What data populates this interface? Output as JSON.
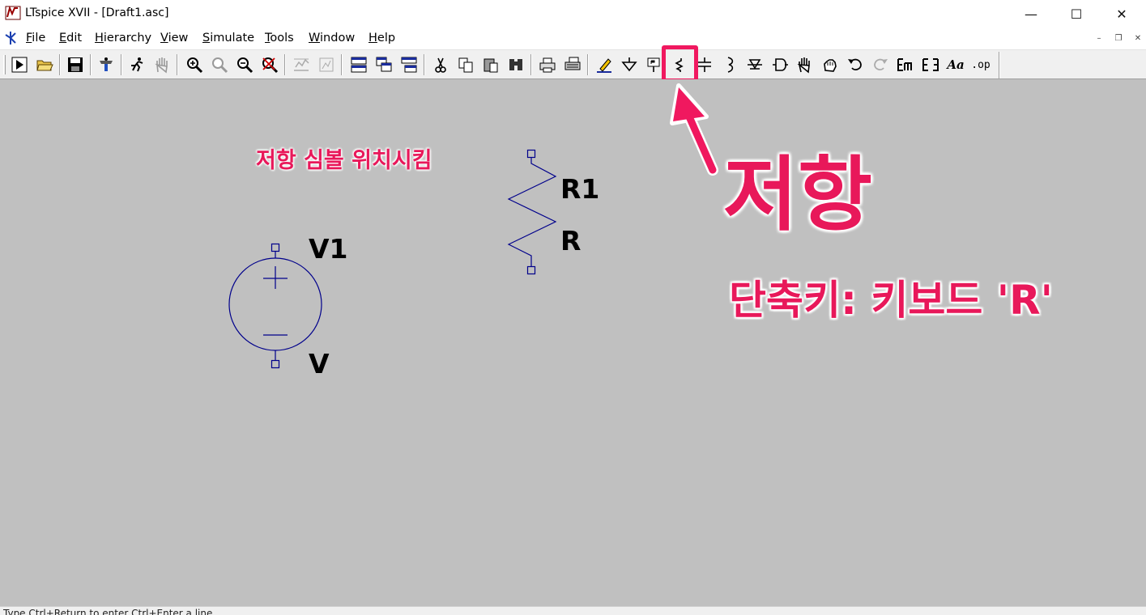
{
  "window": {
    "title": "LTspice XVII - [Draft1.asc]",
    "minimize_glyph": "—",
    "maximize_glyph": "☐",
    "close_glyph": "✕"
  },
  "menu": {
    "items": [
      {
        "hotkey": "F",
        "rest": "ile"
      },
      {
        "hotkey": "E",
        "rest": "dit"
      },
      {
        "hotkey": "H",
        "rest": "ierarchy"
      },
      {
        "hotkey": "V",
        "rest": "iew"
      },
      {
        "hotkey": "S",
        "rest": "imulate"
      },
      {
        "hotkey": "T",
        "rest": "ools"
      },
      {
        "hotkey": "W",
        "rest": "indow"
      },
      {
        "hotkey": "H",
        "rest": "elp"
      }
    ],
    "mdi_min": "–",
    "mdi_restore": "❐",
    "mdi_close": "✕"
  },
  "toolbar": {
    "icons": [
      "run-icon",
      "open-icon",
      "save-icon",
      "control-panel-icon",
      "run-man-icon",
      "pan-hand-icon",
      "zoom-in-icon",
      "zoom-full-icon",
      "zoom-out-icon",
      "zoom-cancel-icon",
      "autorange-icon",
      "fit-icon",
      "tile-horizontal-icon",
      "cascade-icon",
      "tile-vertical-icon",
      "cut-icon",
      "copy-icon",
      "paste-icon",
      "find-icon",
      "print-icon",
      "print-preview-icon",
      "draw-wire-icon",
      "ground-icon",
      "label-net-icon",
      "resistor-icon",
      "capacitor-icon",
      "inductor-icon",
      "diode-icon",
      "component-icon",
      "move-icon",
      "drag-icon",
      "undo-icon",
      "redo-icon",
      "rotate-icon",
      "mirror-icon",
      "text-icon",
      "spice-directive-icon"
    ],
    "text_glyph": "Aa",
    "op_glyph": ".op",
    "highlighted": "resistor-icon",
    "highlight_color": "#f0185f"
  },
  "schematic": {
    "resistor": {
      "ref": "R1",
      "value": "R"
    },
    "source": {
      "ref": "V1",
      "value": "V"
    },
    "wire_color": "#00008b"
  },
  "annotations": {
    "place_symbol": "저항 심볼 위치시킴",
    "big_title": "저항",
    "shortcut": "단축키: 키보드 'R'",
    "color": "#e8185a"
  },
  "status": {
    "text": "Type Ctrl+Return to enter Ctrl+Enter a line"
  }
}
